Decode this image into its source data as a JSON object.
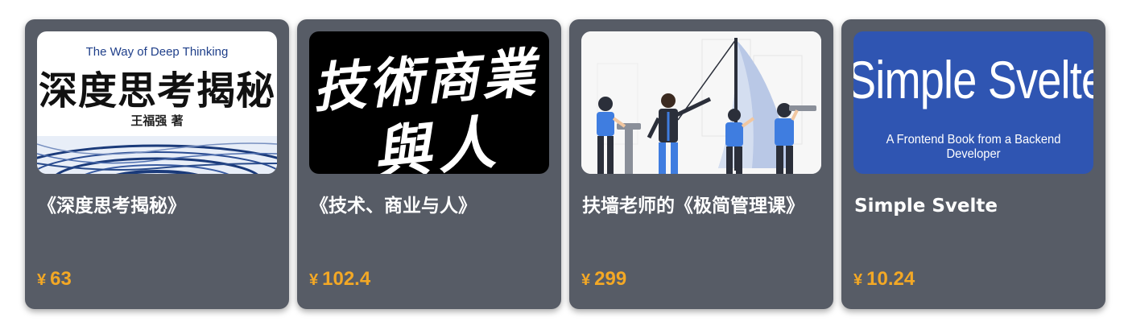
{
  "products": [
    {
      "title": "《深度思考揭秘》",
      "currency": "¥",
      "price": "63",
      "cover": {
        "subtitle": "The Way of Deep Thinking",
        "main": "深度思考揭秘",
        "author": "王福强 著"
      }
    },
    {
      "title": "《技术、商业与人》",
      "currency": "¥",
      "price": "102.4",
      "cover": {
        "line1": "技術商業",
        "line2": "與人"
      }
    },
    {
      "title": "扶墙老师的《极简管理课》",
      "currency": "¥",
      "price": "299",
      "cover": {
        "illustration": "team-telescope-illustration"
      }
    },
    {
      "title": "Simple Svelte",
      "currency": "¥",
      "price": "10.24",
      "cover": {
        "main": "Simple Svelte",
        "subtitle": "A Frontend Book from a Backend Developer"
      }
    }
  ],
  "colors": {
    "card_bg": "#575c66",
    "price": "#f3a825",
    "title": "#ffffff",
    "svelte_cover": "#2f55b2"
  }
}
